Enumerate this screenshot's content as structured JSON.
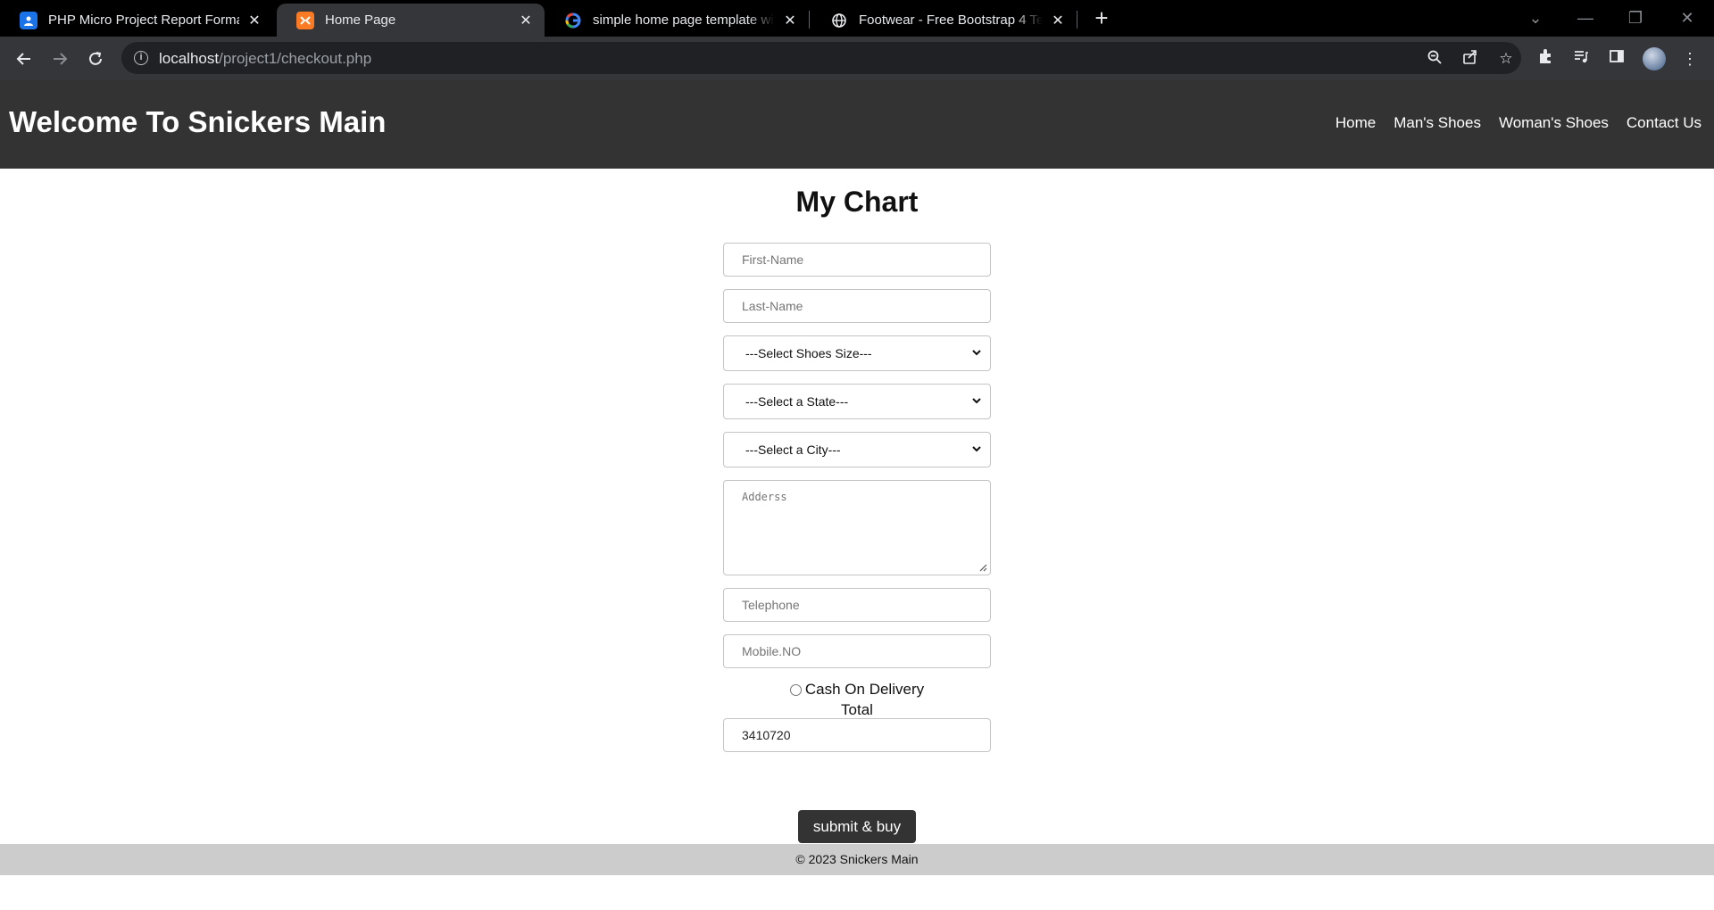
{
  "browser": {
    "tabs": [
      {
        "title": "PHP Micro Project Report Format",
        "active": false,
        "favicon": "docs-icon",
        "favicon_color": "#1a73e8"
      },
      {
        "title": "Home Page",
        "active": true,
        "favicon": "xampp-icon",
        "favicon_color": "#fb7a24"
      },
      {
        "title": "simple home page template with",
        "active": false,
        "favicon": "google-icon",
        "favicon_color": "#ffffff"
      },
      {
        "title": "Footwear - Free Bootstrap 4 Tem",
        "active": false,
        "favicon": "globe-icon",
        "favicon_color": "#e8eaed"
      }
    ],
    "url_host": "localhost",
    "url_path": "/project1/checkout.php"
  },
  "site": {
    "title": "Welcome To Snickers Main",
    "nav": [
      "Home",
      "Man's Shoes",
      "Woman's Shoes",
      "Contact Us"
    ],
    "header_color": "#333333"
  },
  "form": {
    "heading": "My Chart",
    "first_name_placeholder": "First-Name",
    "last_name_placeholder": "Last-Name",
    "shoe_size_selected": "---Select Shoes Size---",
    "state_selected": "---Select a State---",
    "city_selected": "---Select a City---",
    "address_placeholder": "Adderss",
    "telephone_placeholder": "Telephone",
    "mobile_placeholder": "Mobile.NO",
    "payment_option": "Cash On Delivery",
    "total_label": "Total",
    "total_value": "3410720",
    "submit_label": "submit & buy"
  },
  "footer": {
    "text": "© 2023 Snickers Main"
  }
}
